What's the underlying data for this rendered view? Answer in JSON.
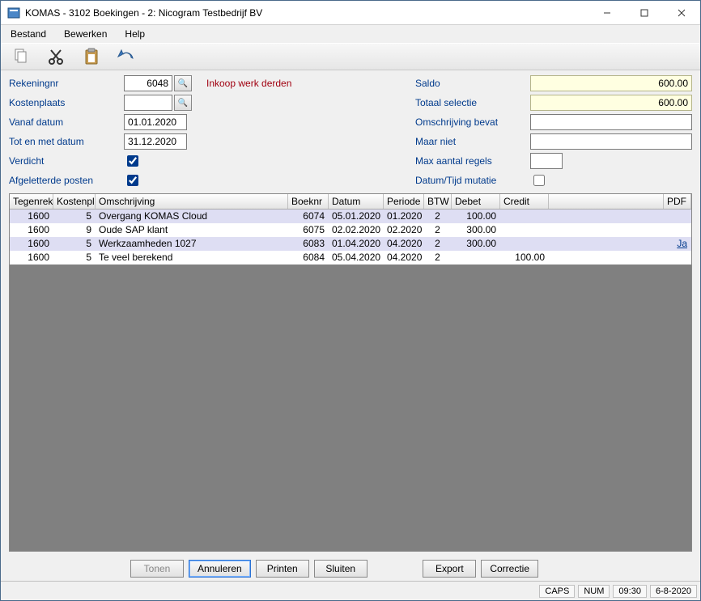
{
  "window": {
    "title": "KOMAS - 3102 Boekingen - 2: Nicogram Testbedrijf BV"
  },
  "menu": {
    "bestand": "Bestand",
    "bewerken": "Bewerken",
    "help": "Help"
  },
  "form": {
    "rekeningnr_label": "Rekeningnr",
    "rekeningnr_value": "6048",
    "rekening_desc": "Inkoop werk derden",
    "kostenplaats_label": "Kostenplaats",
    "kostenplaats_value": "",
    "vanaf_label": "Vanaf datum",
    "vanaf_value": "01.01.2020",
    "tot_label": "Tot en met datum",
    "tot_value": "31.12.2020",
    "verdicht_label": "Verdicht",
    "verdicht_checked": true,
    "afgeletterde_label": "Afgeletterde posten",
    "afgeletterde_checked": true,
    "saldo_label": "Saldo",
    "saldo_value": "600.00",
    "totaal_label": "Totaal selectie",
    "totaal_value": "600.00",
    "omschr_bevat_label": "Omschrijving bevat",
    "omschr_bevat_value": "",
    "maar_niet_label": "Maar niet",
    "maar_niet_value": "",
    "max_regels_label": "Max aantal regels",
    "max_regels_value": "",
    "datumtijd_label": "Datum/Tijd mutatie",
    "datumtijd_checked": false
  },
  "table": {
    "headers": {
      "tegenrek": "Tegenrek",
      "kostenpl": "Kostenpl",
      "omschrijving": "Omschrijving",
      "boeknr": "Boeknr",
      "datum": "Datum",
      "periode": "Periode",
      "btw": "BTW",
      "debet": "Debet",
      "credit": "Credit",
      "pdf": "PDF"
    },
    "rows": [
      {
        "tegenrek": "1600",
        "kostenpl": "5",
        "omschrijving": "Overgang KOMAS Cloud",
        "boeknr": "6074",
        "datum": "05.01.2020",
        "periode": "01.2020",
        "btw": "2",
        "debet": "100.00",
        "credit": "",
        "pdf": ""
      },
      {
        "tegenrek": "1600",
        "kostenpl": "9",
        "omschrijving": "Oude SAP klant",
        "boeknr": "6075",
        "datum": "02.02.2020",
        "periode": "02.2020",
        "btw": "2",
        "debet": "300.00",
        "credit": "",
        "pdf": ""
      },
      {
        "tegenrek": "1600",
        "kostenpl": "5",
        "omschrijving": "Werkzaamheden 1027",
        "boeknr": "6083",
        "datum": "01.04.2020",
        "periode": "04.2020",
        "btw": "2",
        "debet": "300.00",
        "credit": "",
        "pdf": "Ja"
      },
      {
        "tegenrek": "1600",
        "kostenpl": "5",
        "omschrijving": "Te veel berekend",
        "boeknr": "6084",
        "datum": "05.04.2020",
        "periode": "04.2020",
        "btw": "2",
        "debet": "",
        "credit": "100.00",
        "pdf": ""
      }
    ]
  },
  "buttons": {
    "tonen": "Tonen",
    "annuleren": "Annuleren",
    "printen": "Printen",
    "sluiten": "Sluiten",
    "export": "Export",
    "correctie": "Correctie"
  },
  "status": {
    "caps": "CAPS",
    "num": "NUM",
    "time": "09:30",
    "date": "6-8-2020"
  }
}
